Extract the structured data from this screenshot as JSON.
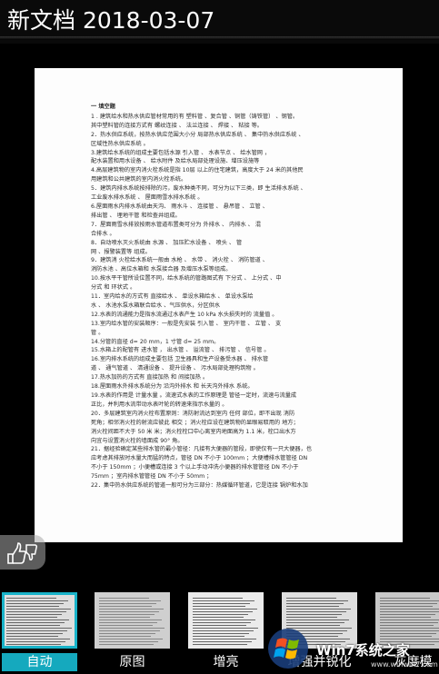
{
  "header": {
    "title": "新文档 2018-03-07"
  },
  "document": {
    "lines": [
      "一 填空题",
      "1 . 建筑给水和热水供应管材常用的有  塑料管   、复合管   、铜管（铸铁管）  、钢管。",
      "其中塑料管的连接方式有     螺纹连接    、   法兰连接   、   焊接    、   粘接    等。",
      "2．热水供应系统，按热水供应范围大小分    局部热水供应系统 、     集中热水供应系统 、",
      "区域性热水供应系统     。",
      "3.建筑给水系统的组成主要包括水源      引入管        、      水表节点       、   给水管网  ，",
      "配水装置和用水设备          、     给水附件      及给水局部处理设施、增压设施等",
      "4.高层建筑物的室内消火栓系统是指   10层   以上的住宅建筑，高度大于   24 米的其他民",
      "用建筑和公共建筑的室内消火栓系统。",
      "5．建筑内排水系统按排除的污，废水种类不同，可分为以下三类，即    生活排水系统 、",
      "    工业废水排水系统      、       屋面雨雪水排水系统 。",
      "6.屋面雨水内排水系统由天沟、   雨水斗     、   连接管       、  悬吊管     、  立管    、",
      "   排出管     、   埋地干管    和检查井组成。",
      "7．屋面雨雪水排放按雨水管道布置类可分为   外排水    、       内排水        、   混",
      "合排水    。",
      "8．自动喷水灭火系统由        水源        、       加压贮水设备     、   喷头    、   管",
      "网     、报警装置等   组成。",
      "9．建筑消   火栓给水系统一般由     水枪     、    水带      、   消火栓     、  消防管道      、",
      "消防水池   、高位水箱和     水泵接合器    及增压水泵等组成。",
      "10.按水平干管所设位置不同，给水系统的管路图式有       下分式       、   上分式      、中",
      "分式    和       环状式          。",
      "11．室内给水的方式有     直接给水          、       单设水箱给水          、    单设水泵给",
      "水       、      水池水泵水箱联合给水      、气压供水，分区供水",
      "12.水表的流通能力是指水流通过水表产生  10   kPa 水头损失时的    流量值    。",
      "13.室内给水管的安装顺序：一般是先安装   引入管     、    室内干管      、    立管     、   支",
      "管         。",
      "14.分管的直径 d=    20    mm，1 寸管 d=    25    mm。",
      "15.水箱上的配管有    进水管   ，  出水管    、  溢流管     、  排污管     、  信号管      。",
      "16.室内排水系统的组成主要包括    卫生器具和生产设备受水器   、     排水管",
      "道       、  通气管道       、  清通设备         、 提升设备      、  污水局部处理构筑物   。",
      "17.热水加热的方式有       直接加热        和    间接加热     。",
      "18.屋面雨水外排水系统分为     沿沟外排水  和     长天沟外排水    系统。",
      "19.水表的作用是       计量水量   。流速式水表的工作原理是     管径一定时，流速与流量成",
      "正比，并利用水流带动水表叶轮的转速来指示水量的      。",
      "20．多层建筑室内消火栓布置原则：消防射流达到室内    任何    部位，即不出现     消防",
      "死角；相邻消火栓的射流应彼此     相交  ；消火栓应设在建筑物的显眼易取用的     地方；",
      "消火栓间距不大于     50  米     米；消火栓栓口中心离室内地面高为     1.1   米，栓口出水方",
      "向宜与设置消火栓的墙面成  90°  角。",
      "21．据经验确定某些排水管的最小管径：凡接有大便器的管段，即使仅有一只大便器，也",
      "应考虑其排放时水量大而猛的特点，管径 DN 不小于   100mm    ；大便槽排水管管径 DN",
      "不小于   150mm    ；小便槽或连接 3 个以上手动冲洗小便器的排水管管径 DN 不小于",
      "75mm    ；室内排水管管径 DN 不小于     50mm  ；",
      "22．集中热水供应系统的管道一般可分为三部分：热媒循环管道，它是连接  锅炉和水加"
    ]
  },
  "filters": [
    {
      "label": "自动",
      "active": true
    },
    {
      "label": "原图",
      "active": false
    },
    {
      "label": "增亮",
      "active": false
    },
    {
      "label": "增强并锐化",
      "active": false
    },
    {
      "label": "灰度模",
      "active": false
    }
  ],
  "watermark": {
    "text": "Win7系统之家",
    "sub": "www.winwin7.com"
  }
}
